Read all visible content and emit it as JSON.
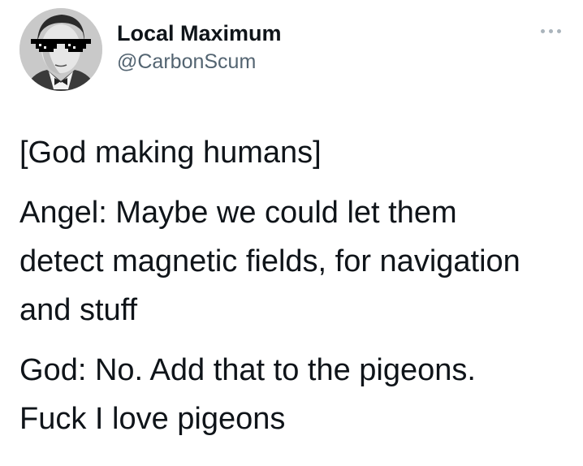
{
  "author": {
    "display_name": "Local Maximum",
    "handle": "@CarbonScum",
    "avatar_icon": "profile-avatar-with-pixel-sunglasses"
  },
  "more_icon": "more-horizontal-icon",
  "tweet": {
    "paragraphs": [
      {
        "lines": [
          "[God making humans]"
        ]
      },
      {
        "lines": [
          "Angel: Maybe we could let them",
          "detect magnetic fields, for navigation",
          "and stuff"
        ]
      },
      {
        "lines": [
          "God: No. Add that to the pigeons.",
          "Fuck I love pigeons"
        ]
      }
    ]
  },
  "colors": {
    "text": "#0f1419",
    "secondary_text": "#536471",
    "more_dots": "#aab4bc"
  }
}
